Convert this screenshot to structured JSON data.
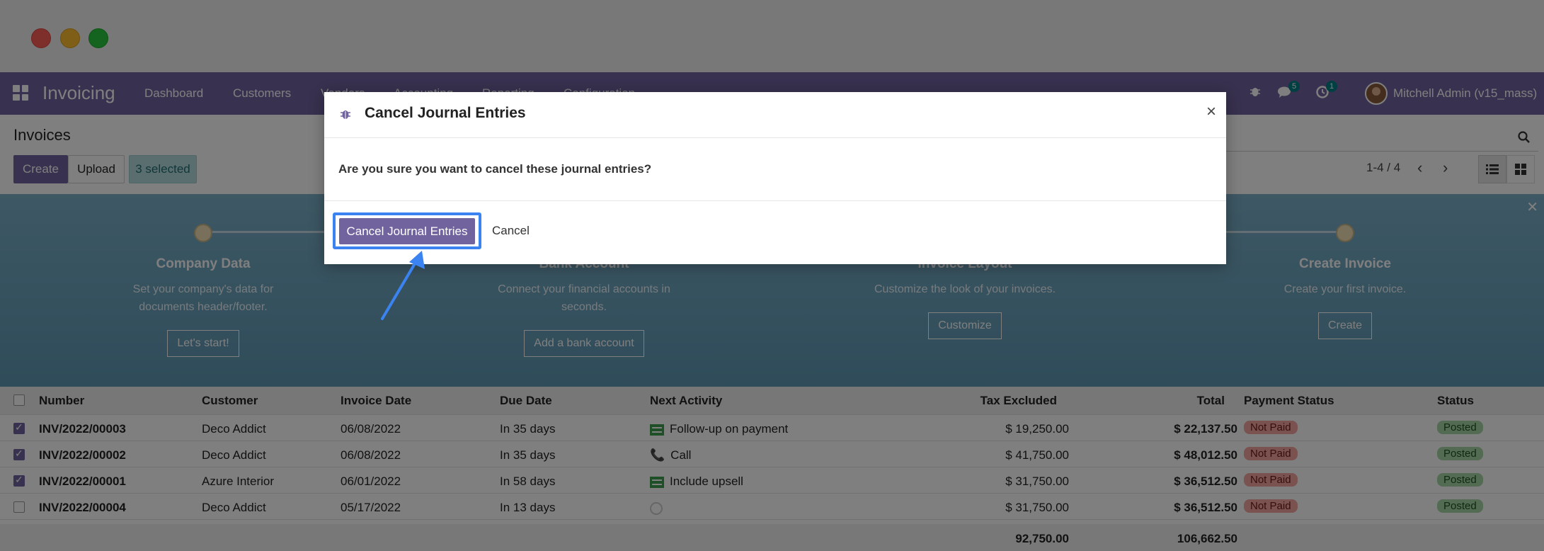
{
  "navbar": {
    "app_name": "Invoicing",
    "menu": [
      "Dashboard",
      "Customers",
      "Vendors",
      "Accounting",
      "Reporting",
      "Configuration"
    ],
    "messages_count": "5",
    "activities_count": "1",
    "user": "Mitchell Admin (v15_mass)"
  },
  "control": {
    "title": "Invoices",
    "create_label": "Create",
    "upload_label": "Upload",
    "selected_label": "3 selected",
    "pager": "1-4 / 4"
  },
  "onboarding": {
    "steps": [
      {
        "title": "Company Data",
        "desc": "Set your company's data for documents header/footer.",
        "button": "Let's start!"
      },
      {
        "title": "Bank Account",
        "desc": "Connect your financial accounts in seconds.",
        "button": "Add a bank account"
      },
      {
        "title": "Invoice Layout",
        "desc": "Customize the look of your invoices.",
        "button": "Customize"
      },
      {
        "title": "Create Invoice",
        "desc": "Create your first invoice.",
        "button": "Create"
      }
    ]
  },
  "table": {
    "headers": [
      "Number",
      "Customer",
      "Invoice Date",
      "Due Date",
      "Next Activity",
      "Tax Excluded",
      "Total",
      "Payment Status",
      "Status"
    ],
    "rows": [
      {
        "number": "INV/2022/00003",
        "customer": "Deco Addict",
        "invoice_date": "06/08/2022",
        "due_date": "In 35 days",
        "activity": "Follow-up on payment",
        "activity_icon": "todo-icon",
        "tax_excluded": "$ 19,250.00",
        "total": "$ 22,137.50",
        "payment_status": "Not Paid",
        "status": "Posted",
        "checked": true
      },
      {
        "number": "INV/2022/00002",
        "customer": "Deco Addict",
        "invoice_date": "06/08/2022",
        "due_date": "In 35 days",
        "activity": "Call",
        "activity_icon": "phone-icon",
        "tax_excluded": "$ 41,750.00",
        "total": "$ 48,012.50",
        "payment_status": "Not Paid",
        "status": "Posted",
        "checked": true
      },
      {
        "number": "INV/2022/00001",
        "customer": "Azure Interior",
        "invoice_date": "06/01/2022",
        "due_date": "In 58 days",
        "activity": "Include upsell",
        "activity_icon": "todo-icon",
        "tax_excluded": "$ 31,750.00",
        "total": "$ 36,512.50",
        "payment_status": "Not Paid",
        "status": "Posted",
        "checked": true
      },
      {
        "number": "INV/2022/00004",
        "customer": "Deco Addict",
        "invoice_date": "05/17/2022",
        "due_date": "In 13 days",
        "activity": "",
        "activity_icon": "clock-icon",
        "tax_excluded": "$ 31,750.00",
        "total": "$ 36,512.50",
        "payment_status": "Not Paid",
        "status": "Posted",
        "checked": false
      }
    ],
    "total_tax_excluded": "92,750.00",
    "total_total": "106,662.50"
  },
  "modal": {
    "title": "Cancel Journal Entries",
    "body": "Are you sure you want to cancel these journal entries?",
    "confirm_label": "Cancel Journal Entries",
    "cancel_label": "Cancel",
    "close_glyph": "×"
  },
  "colors": {
    "brand": "#71639e",
    "focus": "#3a83f1",
    "not_paid": "#f4a4a0",
    "posted": "#a6d7a7"
  }
}
